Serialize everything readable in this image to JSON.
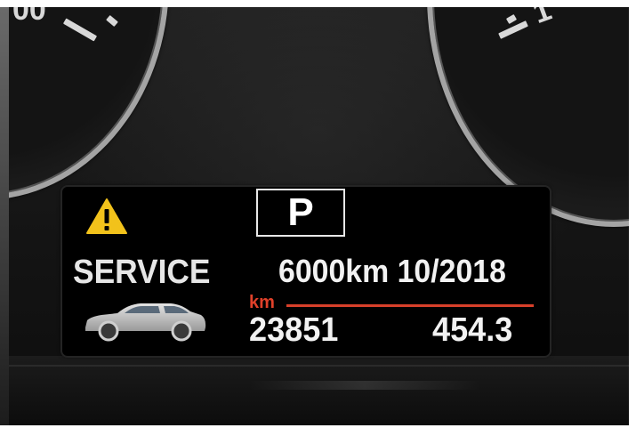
{
  "gauges": {
    "left_partial_number": "00",
    "right_partial_number": "1"
  },
  "display": {
    "gear": "P",
    "service_label": "SERVICE",
    "service_due": "6000km 10/2018",
    "unit": "km",
    "odometer": "23851",
    "trip": "454.3"
  },
  "icons": {
    "warning": "warning-triangle-icon",
    "car": "car-silhouette-icon"
  },
  "colors": {
    "warning_yellow": "#f2c21b",
    "unit_red": "#e0412a",
    "text_white": "#f2f2f2",
    "display_bg": "#000000"
  }
}
